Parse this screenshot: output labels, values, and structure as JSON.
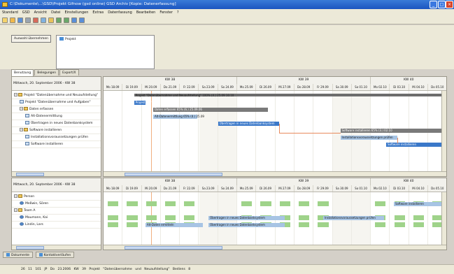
{
  "window": {
    "title": "C:\\Dokumente\\...\\GSD\\Projekt Gifnow (gsd online)  GSD Archiv  [Kopie: Datenerfassung]",
    "minimize": "_",
    "maximize": "□",
    "close": "×"
  },
  "menu": [
    "Standard",
    "GSD",
    "Ansicht",
    "Datei",
    "Einstellungen",
    "Extras",
    "Datenfassung",
    "Bearbeiten",
    "Fenster",
    "?"
  ],
  "toolbar": {
    "icons": [
      "new-icon",
      "open-icon",
      "save-icon",
      "print-icon",
      "cut-icon",
      "copy-icon",
      "paste-icon",
      "undo-icon",
      "redo-icon",
      "zoom-icon",
      "help-icon"
    ]
  },
  "selection": {
    "button_label": "Auswahl übernehmen",
    "project_label": "Projekt"
  },
  "tabs": [
    "Benutzung",
    "Belegungen",
    "Export/X"
  ],
  "gantt_top": {
    "date_label": "Mittwoch, 20. September 2006 - KW 38",
    "weeks": [
      "KW 38",
      "KW 39",
      "KW 40"
    ],
    "days": [
      "Mo 18.09",
      "Di 19.09",
      "Mi 20.09",
      "Do 21.09",
      "Fr 22.09",
      "Sa 23.09",
      "So 24.09",
      "Mo 25.09",
      "Di 26.09",
      "Mi 27.09",
      "Do 28.09",
      "Fr 29.09",
      "Sa 30.09",
      "So 01.10",
      "Mo 02.10",
      "Di 03.10",
      "Mi 04.10",
      "Do 05.10"
    ],
    "rows": [
      {
        "label": "Projekt \"Datenübernahme und Neuaufstellung\"",
        "level": 0,
        "kind": "grp"
      },
      {
        "label": "Projekt \"Datenübernahme und Aufgaben\"",
        "level": 1,
        "kind": "task"
      },
      {
        "label": "Daten erfassen",
        "level": 1,
        "kind": "grp"
      },
      {
        "label": "Alt-Datenermittlung",
        "level": 2,
        "kind": "task"
      },
      {
        "label": "Übertragen in neues Datenbanksystem",
        "level": 2,
        "kind": "task"
      },
      {
        "label": "Software installieren",
        "level": 1,
        "kind": "grp"
      },
      {
        "label": "Installationsvoraussetzungen prüfen",
        "level": 2,
        "kind": "task"
      },
      {
        "label": "Software installieren",
        "level": 2,
        "kind": "task"
      }
    ],
    "bars": [
      {
        "label": "Projekt \"Datenübernahme und Neuaufstellung\" 100% (4.) 25.09 10.10",
        "kind": "sum"
      },
      {
        "label": "Projekt Start",
        "kind": "blue"
      },
      {
        "label": "Daten erfassen 65% (6.) 25.09.06",
        "kind": "grey"
      },
      {
        "label": "Alt-Datenermittlung 65% (4.) 25.09",
        "kind": "light"
      },
      {
        "label": "Übertragen in neues Datenbanksystem",
        "kind": "blue"
      },
      {
        "label": "Software installieren 65% (3.) 02.10",
        "kind": "grey"
      },
      {
        "label": "Installationsvoraussetzungen prüfen",
        "kind": "light"
      },
      {
        "label": "Software installieren",
        "kind": "blue"
      }
    ]
  },
  "gantt_bottom": {
    "date_label": "Mittwoch, 20. September 2006 - KW 38",
    "weeks": [
      "KW 38",
      "KW 39",
      "KW 40"
    ],
    "days": [
      "Mo 18.09",
      "Di 19.09",
      "Mi 20.09",
      "Do 21.09",
      "Fr 22.09",
      "Sa 23.09",
      "So 24.09",
      "Mo 25.09",
      "Di 26.09",
      "Mi 27.09",
      "Do 28.09",
      "Fr 29.09",
      "Sa 30.09",
      "So 01.10",
      "Mo 02.10",
      "Di 03.10",
      "Mi 04.10",
      "Do 05.10"
    ],
    "rows": [
      {
        "label": "Person",
        "level": 0,
        "kind": "grp"
      },
      {
        "label": "Meßwin, Sören",
        "level": 1,
        "kind": "person"
      },
      {
        "label": "Team A",
        "level": 0,
        "kind": "grp"
      },
      {
        "label": "Maumann, Kai",
        "level": 1,
        "kind": "person"
      },
      {
        "label": "Lindin, Lars",
        "level": 1,
        "kind": "person"
      }
    ],
    "bars": [
      {
        "label": "Software installieren",
        "row": 1
      },
      {
        "label": "Übertragen in neues Datenbanksystem",
        "row": 3
      },
      {
        "label": "Installationsvoraussetzungen prüfen",
        "row": 3
      },
      {
        "label": "Alt-Daten ermitteln",
        "row": 4
      },
      {
        "label": "Übertragen in neues Datenbanksystem",
        "row": 4
      }
    ]
  },
  "bottom_tabs": [
    "Dokumente",
    "Kontaktverläufen"
  ],
  "status": "26  11  101  JP     Do 23.2006 KW 39  Projekt \"Datenübernahme und Neuaufstellung\"     Bediens  8"
}
